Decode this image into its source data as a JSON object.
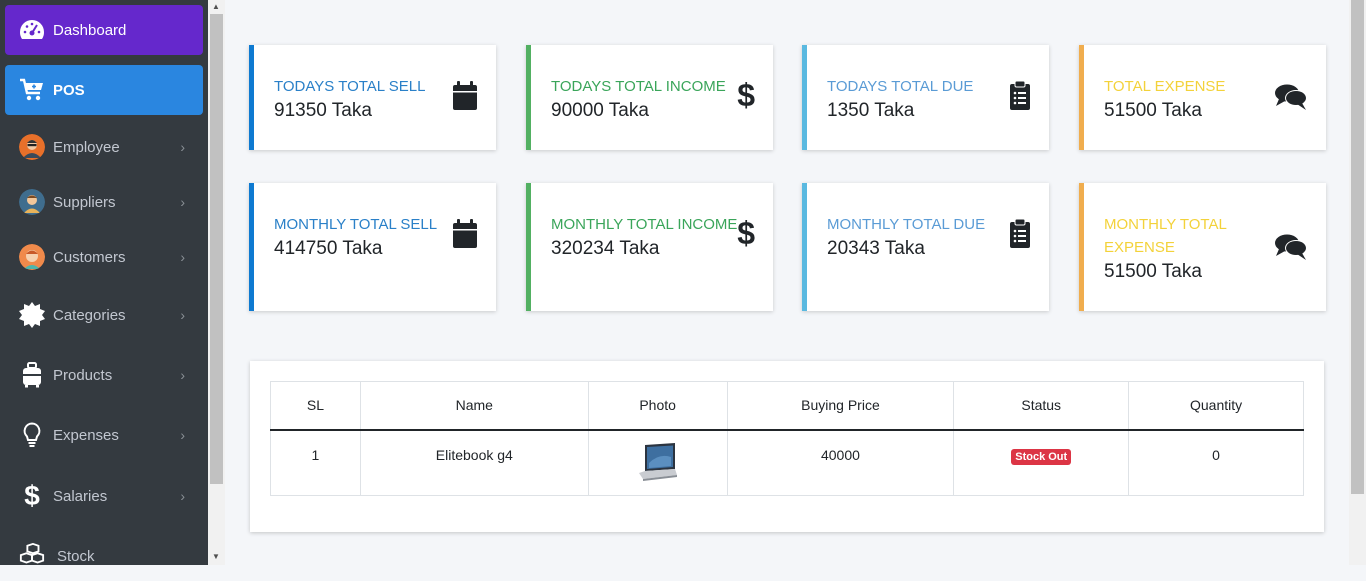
{
  "sidebar": {
    "items": [
      {
        "label": "Dashboard",
        "icon": "tachometer-icon"
      },
      {
        "label": "POS",
        "icon": "cart-icon"
      },
      {
        "label": "Employee",
        "icon": "employee-avatar"
      },
      {
        "label": "Suppliers",
        "icon": "supplier-avatar"
      },
      {
        "label": "Customers",
        "icon": "customer-avatar"
      },
      {
        "label": "Categories",
        "icon": "badge-icon"
      },
      {
        "label": "Products",
        "icon": "suitcase-icon"
      },
      {
        "label": "Expenses",
        "icon": "lightbulb-icon"
      },
      {
        "label": "Salaries",
        "icon": "dollar-icon"
      },
      {
        "label": "Stock",
        "icon": "cubes-icon"
      }
    ]
  },
  "cards": [
    {
      "label": "TODAYS TOTAL SELL",
      "value": "91350 Taka",
      "icon": "calendar-icon",
      "color": "#0e7ad1"
    },
    {
      "label": "TODAYS TOTAL INCOME",
      "value": "90000 Taka",
      "icon": "dollar-icon",
      "color": "#52b062"
    },
    {
      "label": "TODAYS TOTAL DUE",
      "value": "1350 Taka",
      "icon": "clipboard-icon",
      "color": "#5ab9e0"
    },
    {
      "label": "TOTAL EXPENSE",
      "value": "51500 Taka",
      "icon": "comments-icon",
      "color": "#f0ad4e"
    },
    {
      "label": "MONTHLY TOTAL SELL",
      "value": "414750 Taka",
      "icon": "calendar-icon",
      "color": "#0e7ad1"
    },
    {
      "label": "MONTHLY TOTAL INCOME",
      "value": "320234 Taka",
      "icon": "dollar-icon",
      "color": "#52b062"
    },
    {
      "label": "MONTHLY TOTAL DUE",
      "value": "20343 Taka",
      "icon": "clipboard-icon",
      "color": "#5ab9e0"
    },
    {
      "label": "MONTHLY TOTAL EXPENSE",
      "value": "51500 Taka",
      "icon": "comments-icon",
      "color": "#f0ad4e"
    }
  ],
  "table": {
    "headers": [
      "SL",
      "Name",
      "Photo",
      "Buying Price",
      "Status",
      "Quantity"
    ],
    "rows": [
      {
        "sl": "1",
        "name": "Elitebook g4",
        "photo": "laptop-image",
        "price": "40000",
        "status": "Stock Out",
        "quantity": "0"
      }
    ]
  }
}
